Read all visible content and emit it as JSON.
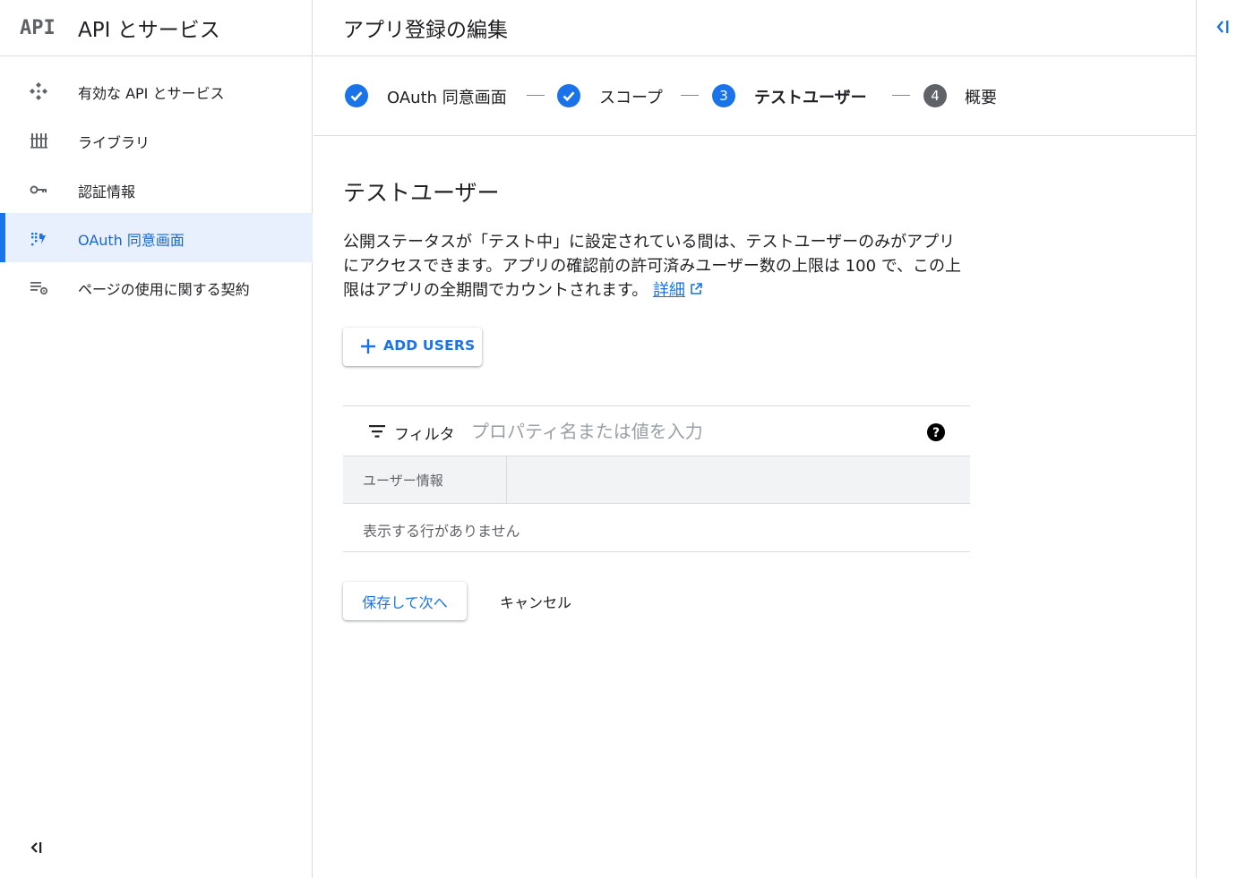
{
  "sidebar": {
    "logo_text": "API",
    "title": "API とサービス",
    "items": [
      {
        "label": "有効な API とサービス",
        "icon": "api-diamond-icon"
      },
      {
        "label": "ライブラリ",
        "icon": "library-icon"
      },
      {
        "label": "認証情報",
        "icon": "key-icon"
      },
      {
        "label": "OAuth 同意画面",
        "icon": "consent-grid-icon",
        "active": true
      },
      {
        "label": "ページの使用に関する契約",
        "icon": "settings-list-icon"
      }
    ],
    "collapse_icon": "collapse-left-icon"
  },
  "page": {
    "title": "アプリ登録の編集"
  },
  "stepper": {
    "steps": [
      {
        "label": "OAuth 同意画面",
        "state": "done",
        "number": ""
      },
      {
        "label": "スコープ",
        "state": "done",
        "number": ""
      },
      {
        "label": "テストユーザー",
        "state": "current",
        "number": "3"
      },
      {
        "label": "概要",
        "state": "upcoming",
        "number": "4"
      }
    ]
  },
  "section": {
    "title": "テストユーザー",
    "description": "公開ステータスが「テスト中」に設定されている間は、テストユーザーのみがアプリにアクセスできます。アプリの確認前の許可済みユーザー数の上限は 100 で、この上限はアプリの全期間でカウントされます。",
    "learn_more": "詳細"
  },
  "add_users_label": "ADD USERS",
  "table": {
    "filter_label": "フィルタ",
    "filter_placeholder": "プロパティ名または値を入力",
    "columns": [
      "ユーザー情報",
      ""
    ],
    "empty_message": "表示する行がありません"
  },
  "actions": {
    "save_label": "保存して次へ",
    "cancel_label": "キャンセル"
  },
  "colors": {
    "accent": "#1a73e8",
    "active_bg": "#e8f0fe",
    "done_step": "#1a73e8",
    "upcoming_step": "#5f6368",
    "border": "#dadce0"
  }
}
